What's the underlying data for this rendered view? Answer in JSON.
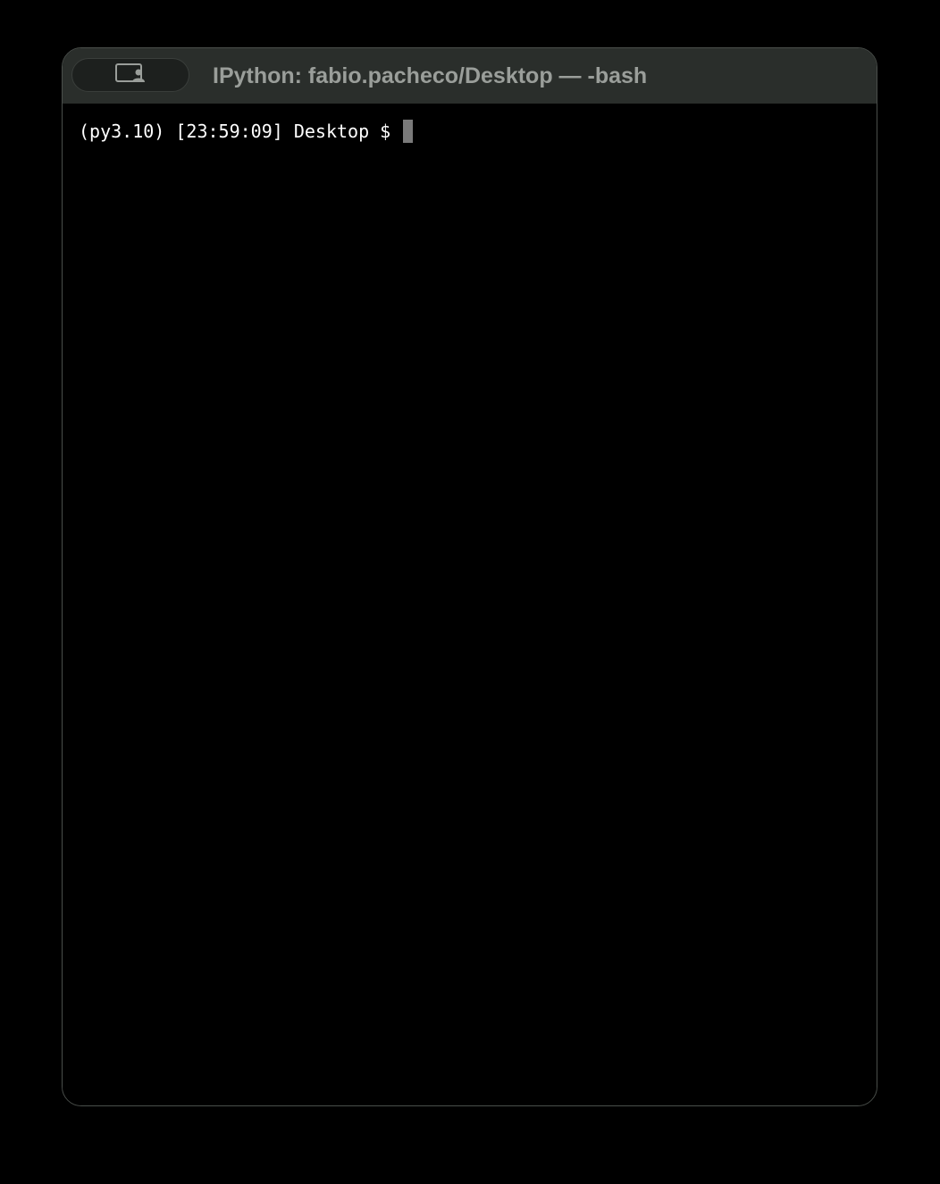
{
  "window": {
    "title": "IPython: fabio.pacheco/Desktop — -bash"
  },
  "titlebar": {
    "screen_share_icon": "screen-share-icon"
  },
  "terminal": {
    "prompt": "(py3.10) [23:59:09] Desktop $ ",
    "input": ""
  },
  "colors": {
    "background": "#000000",
    "titlebar": "#2a2e2b",
    "title_text": "#9a9e9a",
    "prompt_text": "#ffffff",
    "cursor": "#7a7a7a"
  }
}
